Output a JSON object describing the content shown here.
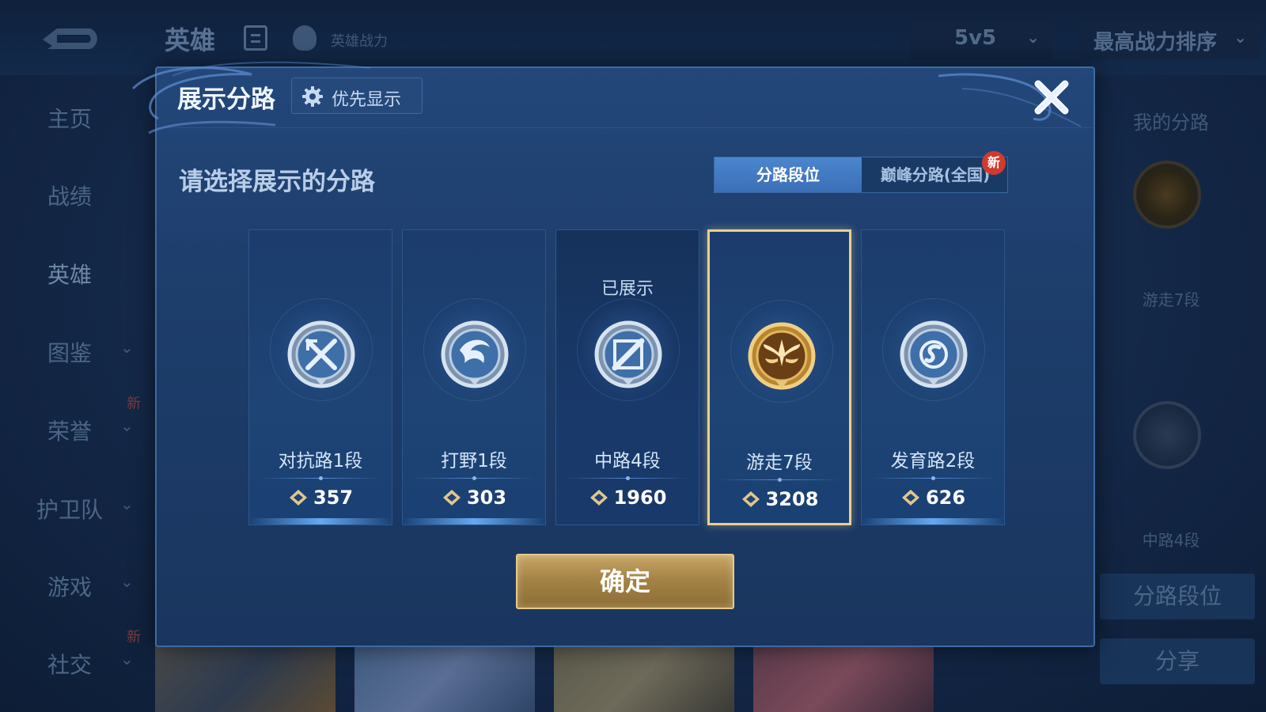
{
  "background": {
    "title": "英雄",
    "power_label": "英雄战力",
    "mode_select": "5v5",
    "sort_select": "最高战力排序",
    "sidebar": [
      {
        "label": "主页",
        "chevron": false,
        "new": false,
        "active": false
      },
      {
        "label": "战绩",
        "chevron": false,
        "new": false,
        "active": false
      },
      {
        "label": "英雄",
        "chevron": false,
        "new": false,
        "active": true
      },
      {
        "label": "图鉴",
        "chevron": true,
        "new": false,
        "active": false
      },
      {
        "label": "荣誉",
        "chevron": true,
        "new": true,
        "active": false
      },
      {
        "label": "护卫队",
        "chevron": true,
        "new": false,
        "active": false
      },
      {
        "label": "游戏",
        "chevron": true,
        "new": false,
        "active": false
      },
      {
        "label": "社交",
        "chevron": true,
        "new": true,
        "active": false
      }
    ],
    "new_tag": "新",
    "right_panel": {
      "title": "我的分路",
      "lane_1": "游走7段",
      "lane_2": "中路4段",
      "lane_rank_button": "分路段位",
      "share_button": "分享"
    }
  },
  "modal": {
    "title": "展示分路",
    "priority_button": "优先显示",
    "prompt": "请选择展示的分路",
    "tabs": [
      {
        "label": "分路段位",
        "active": true
      },
      {
        "label": "巅峰分路(全国)",
        "active": false,
        "new": "新"
      }
    ],
    "cards": [
      {
        "lane": "对抗路1段",
        "score": "357",
        "status": "",
        "emblem": "clash-lane-emblem",
        "tier": "silver",
        "selected": false
      },
      {
        "lane": "打野1段",
        "score": "303",
        "status": "",
        "emblem": "jungle-dragon-emblem",
        "tier": "silver",
        "selected": false
      },
      {
        "lane": "中路4段",
        "score": "1960",
        "status": "已展示",
        "emblem": "mid-lane-emblem",
        "tier": "silver",
        "selected": false
      },
      {
        "lane": "游走7段",
        "score": "3208",
        "status": "",
        "emblem": "roam-wings-emblem",
        "tier": "gold",
        "selected": true
      },
      {
        "lane": "发育路2段",
        "score": "626",
        "status": "",
        "emblem": "farm-lane-emblem",
        "tier": "silver",
        "selected": false
      }
    ],
    "confirm_button": "确定"
  },
  "colors": {
    "modal_bg": "#1d3d6b",
    "tab_active": "#4b86cf",
    "selected_border": "#ead08e",
    "confirm_gold": "#a58447",
    "new_badge": "#d33a2f"
  }
}
